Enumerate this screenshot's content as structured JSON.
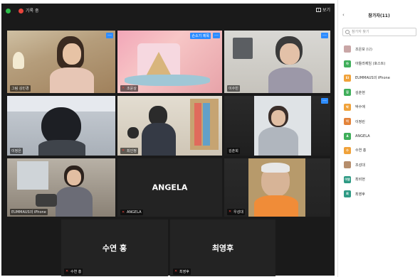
{
  "meeting": {
    "recording_label": "기록 중",
    "view_label": "보기"
  },
  "tiles": [
    {
      "name": "그림 김민경",
      "big": ""
    },
    {
      "name": "조윤상",
      "big": "",
      "tag": "손소기 제목"
    },
    {
      "name": "이수빈",
      "big": ""
    },
    {
      "name": "이정은",
      "big": ""
    },
    {
      "name": "최인정",
      "big": ""
    },
    {
      "name": "김춘희",
      "big": ""
    },
    {
      "name": "EUMMAUS의 iPhone",
      "big": ""
    },
    {
      "name": "ANGELA",
      "big": "ANGELA"
    },
    {
      "name": "우성대",
      "big": ""
    },
    {
      "name": "수연 홍",
      "big": "수연 홍"
    },
    {
      "name": "최영후",
      "big": "최영후"
    }
  ],
  "panel": {
    "title": "참가자(11)",
    "search_placeholder": "참가자 찾기",
    "participants": [
      {
        "name": "조은보 (나)",
        "avatar": "",
        "color": "#c9a6a6"
      },
      {
        "name": "아들라제임 (호스트)",
        "avatar": "아",
        "color": "#3fae5a"
      },
      {
        "name": "EUMMAUS의 iPhone",
        "avatar": "EI",
        "color": "#f0a23a"
      },
      {
        "name": "김춘현",
        "avatar": "김",
        "color": "#3fae5a"
      },
      {
        "name": "박수애",
        "avatar": "박",
        "color": "#f0a23a"
      },
      {
        "name": "이정린",
        "avatar": "이",
        "color": "#e3833a"
      },
      {
        "name": "ANGELA",
        "avatar": "A",
        "color": "#3fae5a"
      },
      {
        "name": "수연 홍",
        "avatar": "수",
        "color": "#f0a23a"
      },
      {
        "name": "조성대",
        "avatar": "",
        "color": "#b68e6c"
      },
      {
        "name": "최비현",
        "avatar": "이영",
        "color": "#2e9a84"
      },
      {
        "name": "최영후",
        "avatar": "최",
        "color": "#2e9a84"
      }
    ]
  }
}
